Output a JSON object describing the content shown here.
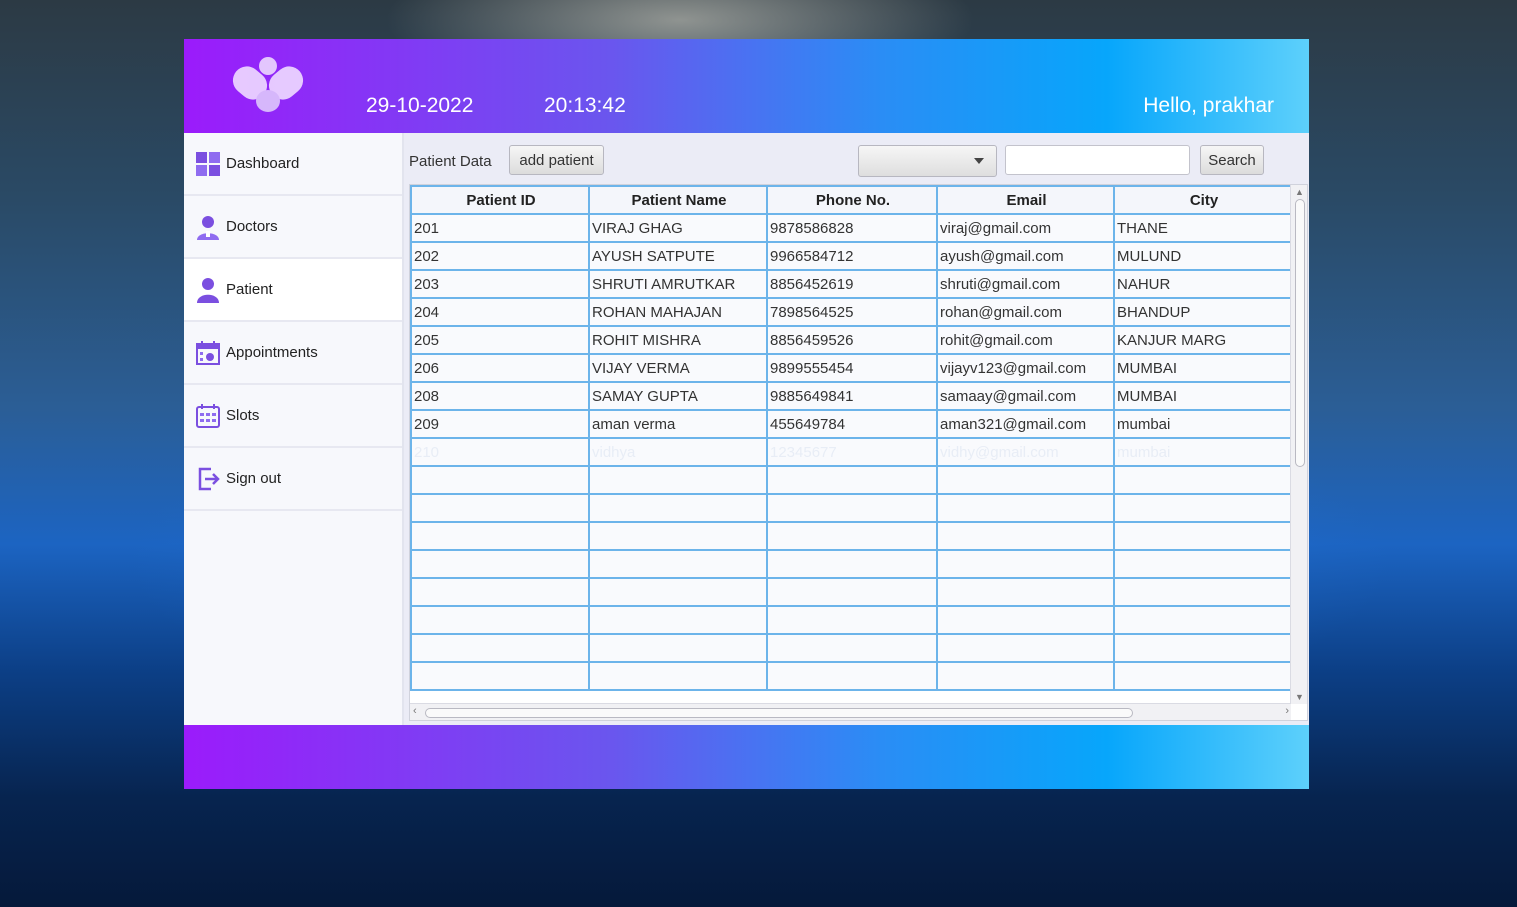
{
  "header": {
    "date": "29-10-2022",
    "time": "20:13:42",
    "greeting": "Hello, prakhar"
  },
  "sidebar": {
    "items": [
      {
        "label": "Dashboard",
        "icon": "dashboard-icon"
      },
      {
        "label": "Doctors",
        "icon": "doctor-icon"
      },
      {
        "label": "Patient",
        "icon": "patient-icon"
      },
      {
        "label": "Appointments",
        "icon": "calendar-icon"
      },
      {
        "label": "Slots",
        "icon": "slots-calendar-icon"
      },
      {
        "label": "Sign out",
        "icon": "sign-out-icon"
      }
    ],
    "active": "Patient"
  },
  "toolbar": {
    "title": "Patient Data",
    "add_label": "add patient",
    "filter_value": "",
    "search_value": "",
    "search_label": "Search"
  },
  "table": {
    "columns": [
      "Patient ID",
      "Patient Name",
      "Phone No.",
      "Email",
      "City"
    ],
    "rows": [
      [
        "201",
        "VIRAJ GHAG",
        "9878586828",
        "viraj@gmail.com",
        "THANE"
      ],
      [
        "202",
        "AYUSH SATPUTE",
        "9966584712",
        "ayush@gmail.com",
        "MULUND"
      ],
      [
        "203",
        "SHRUTI AMRUTKAR",
        "8856452619",
        "shruti@gmail.com",
        "NAHUR"
      ],
      [
        "204",
        "ROHAN MAHAJAN",
        "7898564525",
        "rohan@gmail.com",
        "BHANDUP"
      ],
      [
        "205",
        "ROHIT MISHRA",
        "8856459526",
        "rohit@gmail.com",
        "KANJUR MARG"
      ],
      [
        "206",
        "VIJAY VERMA",
        "9899555454",
        "vijayv123@gmail.com",
        "MUMBAI"
      ],
      [
        "208",
        "SAMAY GUPTA",
        "9885649841",
        "samaay@gmail.com",
        "MUMBAI"
      ],
      [
        "209",
        "aman verma",
        "455649784",
        "aman321@gmail.com",
        "mumbai"
      ],
      [
        "210",
        "vidhya",
        "12345677",
        "vidhy@gmail.com",
        "mumbai"
      ]
    ],
    "empty_rows": 8
  },
  "colors": {
    "header_gradient_start": "#9b1bfb",
    "header_gradient_end": "#5dd0fb",
    "grid_line": "#6cb4ea",
    "icon_accent": "#7b4fe0"
  }
}
